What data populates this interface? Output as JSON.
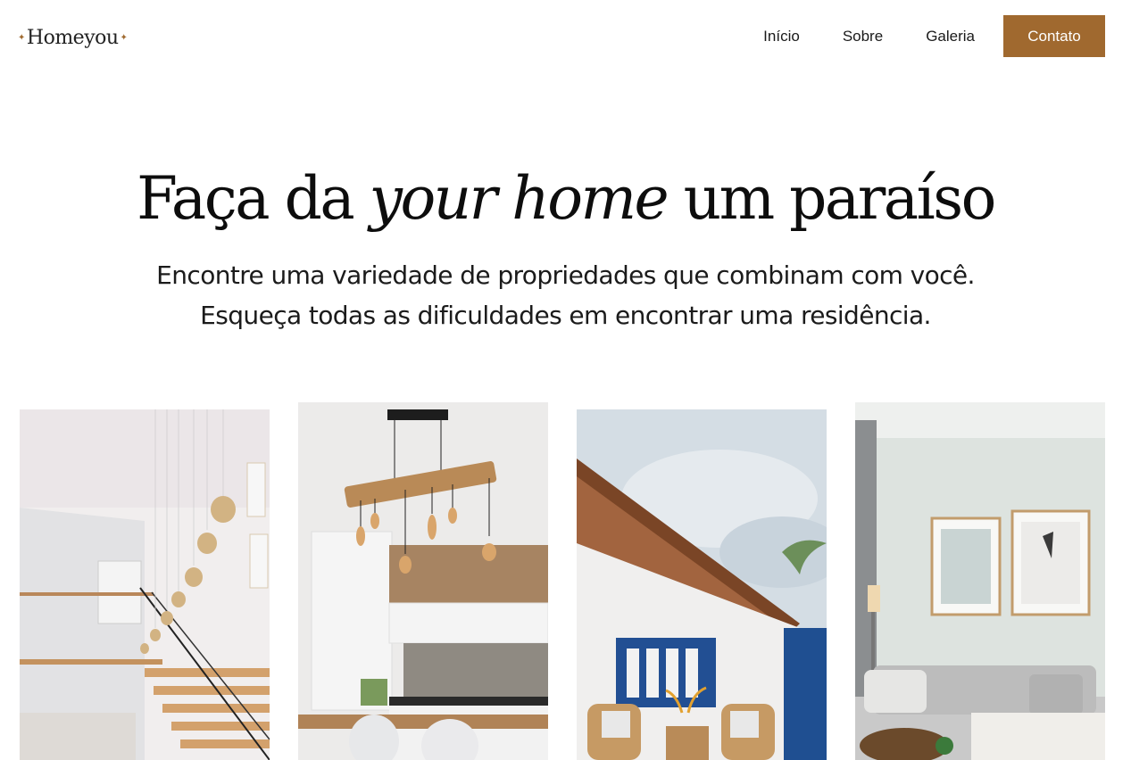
{
  "brand": {
    "name": "Homeyou",
    "accent": "#a0692f"
  },
  "nav": {
    "items": [
      "Início",
      "Sobre",
      "Galeria"
    ],
    "cta": "Contato"
  },
  "hero": {
    "headline_before": "Faça da",
    "headline_italic": "your home",
    "headline_after": "um paraíso",
    "subtitle_line1": "Encontre uma variedade de propriedades que combinam com você.",
    "subtitle_line2": "Esqueça todas as dificuldades em encontrar uma residência."
  },
  "gallery": {
    "images": [
      "staircase-pendant-lights-photo",
      "kitchen-pendant-lamp-photo",
      "house-patio-rattan-chairs-photo",
      "living-room-sofa-frames-photo"
    ]
  }
}
